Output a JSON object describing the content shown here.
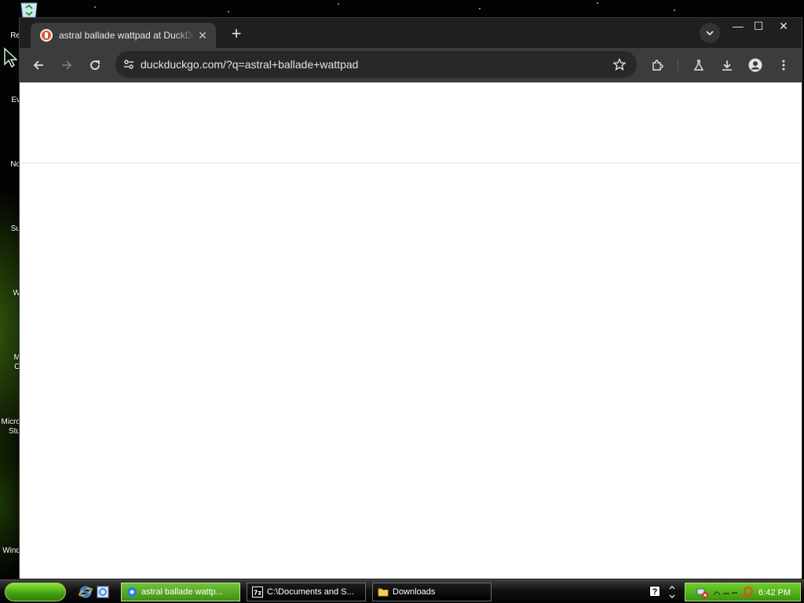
{
  "desktop": {
    "icon_labels": [
      "Re",
      "Ev",
      "No",
      "Su",
      "W",
      "M",
      "O",
      "Micro",
      "Stu",
      "Wind"
    ]
  },
  "browser": {
    "tab": {
      "title": "astral ballade wattpad at DuckDuckGo"
    },
    "omnibox": {
      "url": "duckduckgo.com/?q=astral+ballade+wattpad"
    },
    "window_controls": {
      "minimize": "—",
      "maximize": "☐",
      "close": "✕"
    }
  },
  "taskbar": {
    "tasks": [
      {
        "label": "astral ballade wattp...",
        "active": true
      },
      {
        "label": "C:\\Documents and S...",
        "active": false
      },
      {
        "label": "Downloads",
        "active": false
      }
    ],
    "help": "?",
    "clock": "6:42 PM"
  },
  "colors": {
    "chrome_dark": "#1f1f1f",
    "toolbar": "#3c3c3c",
    "omnibox": "#282828",
    "ddg_orange": "#de5833",
    "xp_green": "#46a412"
  }
}
